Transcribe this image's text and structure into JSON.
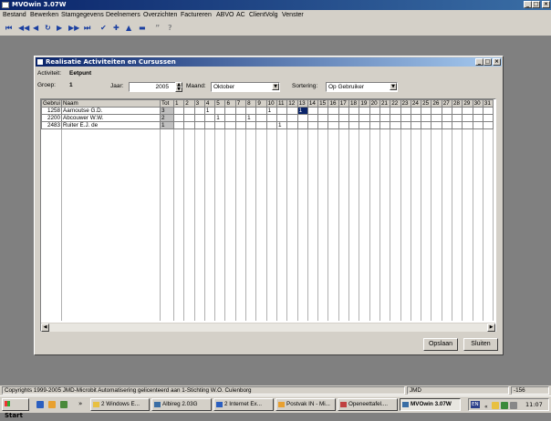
{
  "window": {
    "title": "MVOwin 3.07W"
  },
  "menu": [
    "Bestand",
    "Bewerken",
    "Stamgegevens",
    "Deelnemers",
    "Overzichten",
    "Factureren",
    "ABVO",
    "AC",
    "ClientVolg",
    "Venster"
  ],
  "child": {
    "title": "Realisatie Activiteiten en Cursussen",
    "activiteit_label": "Activiteit:",
    "activiteit_value": "Eetpunt",
    "groep_label": "Groep:",
    "groep_value": "1",
    "jaar_label": "Jaar:",
    "jaar_value": "2005",
    "maand_label": "Maand:",
    "maand_value": "Oktober",
    "sortering_label": "Sortering:",
    "sortering_value": "Op Gebruiker",
    "col_gebr": "Gebrui",
    "col_naam": "Naam",
    "col_tot": "Tot",
    "days": [
      "1",
      "2",
      "3",
      "4",
      "5",
      "6",
      "7",
      "8",
      "9",
      "10",
      "11",
      "12",
      "13",
      "14",
      "15",
      "16",
      "17",
      "18",
      "19",
      "20",
      "21",
      "22",
      "23",
      "24",
      "25",
      "26",
      "27",
      "28",
      "29",
      "30",
      "31"
    ],
    "rows": [
      {
        "gebr": "1258",
        "naam": "Aarnoutse G.D.",
        "tot": "3",
        "marks": {
          "4": "1",
          "10": "1",
          "13": "1"
        }
      },
      {
        "gebr": "2200",
        "naam": "Abcouwer W.W.",
        "tot": "2",
        "marks": {
          "5": "1",
          "8": "1"
        }
      },
      {
        "gebr": "2483",
        "naam": "Ruiter E.J. de",
        "tot": "1",
        "marks": {
          "11": "1"
        }
      }
    ],
    "selected_cell": {
      "row": 0,
      "day": "13"
    },
    "opslaan_label": "Opslaan",
    "sluiten_label": "Sluiten"
  },
  "status": {
    "copyright": "Copyrights 1999-2005 JMD-Microbit Automatisering gelicenteerd aan 1-Stichting W.O. Culenborg",
    "user": "JMD",
    "code": "-156"
  },
  "taskbar": {
    "start": "Start",
    "tasks": [
      {
        "label": "2 Windows E...",
        "active": false
      },
      {
        "label": "Albireg 2.03G",
        "active": false
      },
      {
        "label": "2 Internet Ex...",
        "active": false
      },
      {
        "label": "Postvak IN - Mi...",
        "active": false
      },
      {
        "label": "Openeettafel....",
        "active": false
      },
      {
        "label": "MVOwin 3.07W",
        "active": true
      }
    ],
    "lang": "EN",
    "time": "11:07"
  }
}
